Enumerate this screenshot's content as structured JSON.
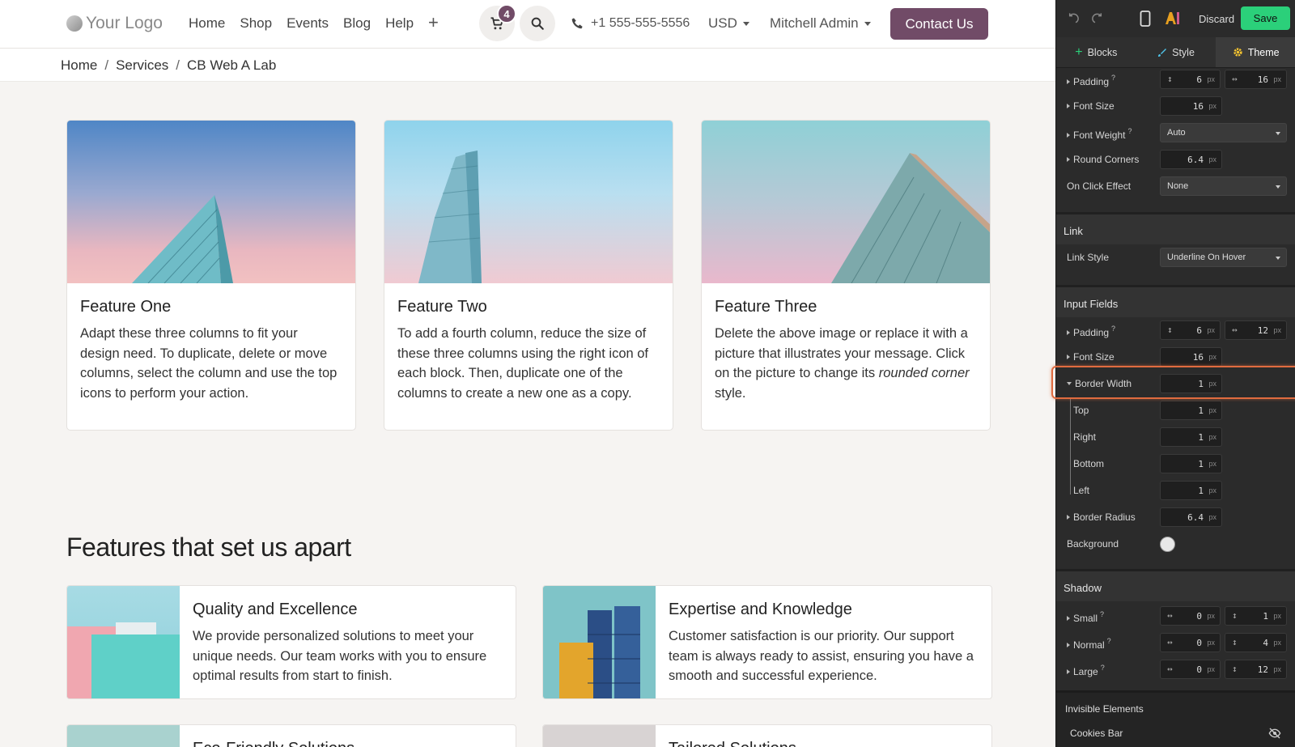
{
  "site": {
    "logo_text": "Your Logo",
    "menu": [
      "Home",
      "Shop",
      "Events",
      "Blog",
      "Help"
    ],
    "cart_count": "4",
    "phone": "+1 555-555-5556",
    "currency": "USD",
    "user": "Mitchell Admin",
    "contact_label": "Contact Us",
    "breadcrumb": [
      "Home",
      "Services",
      "CB Web A Lab"
    ],
    "cards": [
      {
        "title": "Feature One",
        "text": "Adapt these three columns to fit your design need. To duplicate, delete or move columns, select the column and use the top icons to perform your action."
      },
      {
        "title": "Feature Two",
        "text": "To add a fourth column, reduce the size of these three columns using the right icon of each block. Then, duplicate one of the columns to create a new one as a copy."
      },
      {
        "title": "Feature Three",
        "text_before": "Delete the above image or replace it with a picture that illustrates your message. Click on the picture to change its ",
        "text_em": "rounded corner",
        "text_after": " style."
      }
    ],
    "features_heading": "Features that set us apart",
    "features": [
      {
        "title": "Quality and Excellence",
        "text": "We provide personalized solutions to meet your unique needs. Our team works with you to ensure optimal results from start to finish."
      },
      {
        "title": "Expertise and Knowledge",
        "text": "Customer satisfaction is our priority. Our support team is always ready to assist, ensuring you have a smooth and successful experience."
      },
      {
        "title": "Eco-Friendly Solutions",
        "text": ""
      },
      {
        "title": "Tailored Solutions",
        "text": ""
      }
    ]
  },
  "panel": {
    "discard_label": "Discard",
    "save_label": "Save",
    "tabs": [
      "Blocks",
      "Style",
      "Theme"
    ],
    "button": {
      "padding_label": "Padding",
      "padding_y": "6",
      "padding_x": "16",
      "font_size_label": "Font Size",
      "font_size": "16",
      "font_weight_label": "Font Weight",
      "font_weight": "Auto",
      "round_corners_label": "Round Corners",
      "round_corners": "6.4",
      "on_click_label": "On Click Effect",
      "on_click": "None"
    },
    "link": {
      "section": "Link",
      "style_label": "Link Style",
      "style": "Underline On Hover"
    },
    "input": {
      "section": "Input Fields",
      "padding_label": "Padding",
      "padding_y": "6",
      "padding_x": "12",
      "font_size_label": "Font Size",
      "font_size": "16",
      "border_width_label": "Border Width",
      "border_width": "1",
      "top_label": "Top",
      "top": "1",
      "right_label": "Right",
      "right": "1",
      "bottom_label": "Bottom",
      "bottom": "1",
      "left_label": "Left",
      "left": "1",
      "border_radius_label": "Border Radius",
      "border_radius": "6.4",
      "background_label": "Background"
    },
    "shadow": {
      "section": "Shadow",
      "small_label": "Small",
      "small_x": "0",
      "small_y": "1",
      "normal_label": "Normal",
      "normal_x": "0",
      "normal_y": "4",
      "large_label": "Large",
      "large_x": "0",
      "large_y": "12"
    },
    "invisible": {
      "section": "Invisible Elements",
      "cookies_label": "Cookies Bar"
    },
    "unit": "px"
  }
}
